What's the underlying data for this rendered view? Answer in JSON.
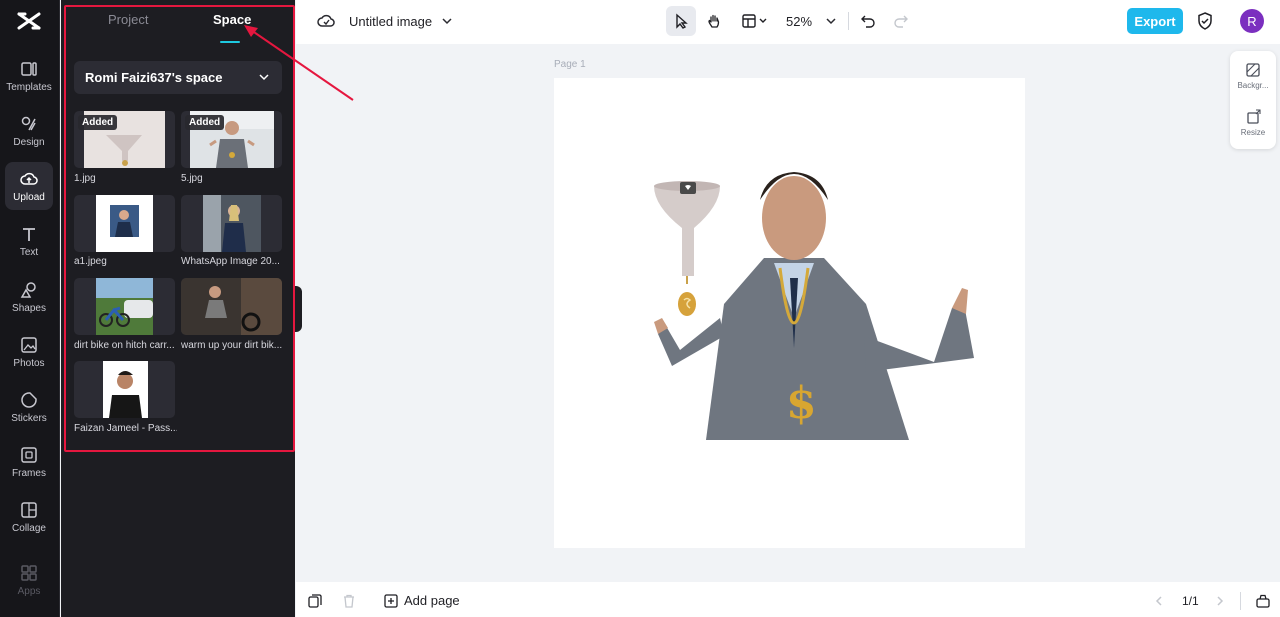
{
  "rail": {
    "items": [
      {
        "label": "Templates",
        "icon": "templates-icon"
      },
      {
        "label": "Design",
        "icon": "design-icon"
      },
      {
        "label": "Upload",
        "icon": "upload-cloud-icon"
      },
      {
        "label": "Text",
        "icon": "text-icon"
      },
      {
        "label": "Shapes",
        "icon": "shapes-icon"
      },
      {
        "label": "Photos",
        "icon": "photos-icon"
      },
      {
        "label": "Stickers",
        "icon": "stickers-icon"
      },
      {
        "label": "Frames",
        "icon": "frames-icon"
      },
      {
        "label": "Collage",
        "icon": "collage-icon"
      },
      {
        "label": "Apps",
        "icon": "apps-icon"
      }
    ]
  },
  "panel": {
    "tabs": [
      {
        "label": "Project"
      },
      {
        "label": "Space"
      }
    ],
    "space_name": "Romi Faizi637's space",
    "files": [
      {
        "name": "1.jpg",
        "badge": "Added"
      },
      {
        "name": "5.jpg",
        "badge": "Added"
      },
      {
        "name": "a1.jpeg",
        "badge": ""
      },
      {
        "name": "WhatsApp Image 20...",
        "badge": ""
      },
      {
        "name": "dirt bike on hitch carr...",
        "badge": ""
      },
      {
        "name": "warm up your dirt bik...",
        "badge": ""
      },
      {
        "name": "Faizan Jameel - Pass...",
        "badge": ""
      }
    ]
  },
  "topbar": {
    "title": "Untitled image",
    "zoom": "52%",
    "export_label": "Export",
    "avatar_initial": "R"
  },
  "canvas": {
    "page_label": "Page 1"
  },
  "side_tools": [
    {
      "label": "Backgr..."
    },
    {
      "label": "Resize"
    }
  ],
  "bottombar": {
    "add_page_label": "Add page",
    "page_indicator": "1/1"
  },
  "colors": {
    "accent": "#1eb8ec",
    "highlight": "#e5173f",
    "panel_bg": "#1d1d22",
    "avatar": "#7b2fbf"
  }
}
